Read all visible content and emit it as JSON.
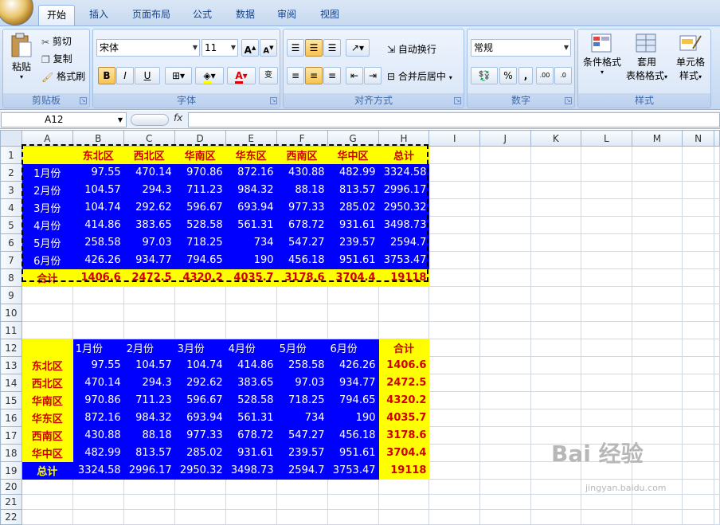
{
  "ribbon_tabs": [
    "开始",
    "插入",
    "页面布局",
    "公式",
    "数据",
    "审阅",
    "视图"
  ],
  "clipboard": {
    "paste": "粘贴",
    "cut": "剪切",
    "copy": "复制",
    "format_painter": "格式刷",
    "title": "剪贴板"
  },
  "font": {
    "name": "宋体",
    "size": "11",
    "title": "字体",
    "bold": "B",
    "italic": "I",
    "underline": "U"
  },
  "alignment": {
    "wrap": "自动换行",
    "merge": "合并后居中",
    "title": "对齐方式"
  },
  "number": {
    "format": "常规",
    "percent": "%",
    "comma": ",",
    "title": "数字"
  },
  "styles": {
    "conditional": "条件格式",
    "table_format_1": "套用",
    "table_format_2": "表格格式",
    "cell_styles_1": "单元格",
    "cell_styles_2": "样式",
    "title": "样式"
  },
  "formula_bar": {
    "name_box": "A12",
    "fx": "fx",
    "value": ""
  },
  "columns": [
    "A",
    "B",
    "C",
    "D",
    "E",
    "F",
    "G",
    "H",
    "I",
    "J",
    "K",
    "L",
    "M",
    "N"
  ],
  "rows": [
    "1",
    "2",
    "3",
    "4",
    "5",
    "6",
    "7",
    "8",
    "9",
    "10",
    "11",
    "12",
    "13",
    "14",
    "15",
    "16",
    "17",
    "18",
    "19",
    "20",
    "21",
    "22"
  ],
  "table1": {
    "headers": [
      "",
      "东北区",
      "西北区",
      "华南区",
      "华东区",
      "西南区",
      "华中区",
      "总计"
    ],
    "rows": [
      [
        "1月份",
        "97.55",
        "470.14",
        "970.86",
        "872.16",
        "430.88",
        "482.99",
        "3324.58"
      ],
      [
        "2月份",
        "104.57",
        "294.3",
        "711.23",
        "984.32",
        "88.18",
        "813.57",
        "2996.17"
      ],
      [
        "3月份",
        "104.74",
        "292.62",
        "596.67",
        "693.94",
        "977.33",
        "285.02",
        "2950.32"
      ],
      [
        "4月份",
        "414.86",
        "383.65",
        "528.58",
        "561.31",
        "678.72",
        "931.61",
        "3498.73"
      ],
      [
        "5月份",
        "258.58",
        "97.03",
        "718.25",
        "734",
        "547.27",
        "239.57",
        "2594.7"
      ],
      [
        "6月份",
        "426.26",
        "934.77",
        "794.65",
        "190",
        "456.18",
        "951.61",
        "3753.47"
      ]
    ],
    "total": [
      "合计",
      "1406.6",
      "2472.5",
      "4320.2",
      "4035.7",
      "3178.6",
      "3704.4",
      "19118"
    ]
  },
  "table2": {
    "headers": [
      "",
      "1月份",
      "2月份",
      "3月份",
      "4月份",
      "5月份",
      "6月份",
      "合计"
    ],
    "rows": [
      [
        "东北区",
        "97.55",
        "104.57",
        "104.74",
        "414.86",
        "258.58",
        "426.26",
        "1406.6"
      ],
      [
        "西北区",
        "470.14",
        "294.3",
        "292.62",
        "383.65",
        "97.03",
        "934.77",
        "2472.5"
      ],
      [
        "华南区",
        "970.86",
        "711.23",
        "596.67",
        "528.58",
        "718.25",
        "794.65",
        "4320.2"
      ],
      [
        "华东区",
        "872.16",
        "984.32",
        "693.94",
        "561.31",
        "734",
        "190",
        "4035.7"
      ],
      [
        "西南区",
        "430.88",
        "88.18",
        "977.33",
        "678.72",
        "547.27",
        "456.18",
        "3178.6"
      ],
      [
        "华中区",
        "482.99",
        "813.57",
        "285.02",
        "931.61",
        "239.57",
        "951.61",
        "3704.4"
      ]
    ],
    "total": [
      "总计",
      "3324.58",
      "2996.17",
      "2950.32",
      "3498.73",
      "2594.7",
      "3753.47",
      "19118"
    ]
  },
  "watermark": {
    "main": "Bai 经验",
    "sub": "jingyan.baidu.com"
  }
}
